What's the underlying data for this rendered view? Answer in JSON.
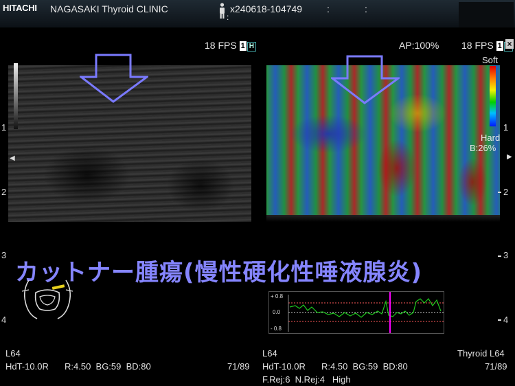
{
  "header": {
    "logo": "HITACHI",
    "clinic": "NAGASAKI Thyroid CLINIC",
    "patient_id": "x240618-104749",
    "sep1": ":",
    "sep2": ":",
    "sep3": ":"
  },
  "left_panel": {
    "fps": "18 FPS",
    "focus_num": "1",
    "focus_mark": "H",
    "depth_marks": [
      "1",
      "2",
      "3",
      "4"
    ],
    "triangle": "◀"
  },
  "right_panel": {
    "ap": "AP:100%",
    "fps": "18 FPS",
    "focus_num": "1",
    "focus_mark": "H",
    "close": "×",
    "scale_soft": "Soft",
    "scale_hard": "Hard",
    "scale_ratio": "B:26%",
    "scale_num": "1",
    "depth_marks": [
      "2",
      "3",
      "4"
    ],
    "triangle": "▶"
  },
  "title_text": "カットナー腫瘍(慢性硬化性唾液腺炎)",
  "strain_graph": {
    "ticks": [
      "+ 0.8",
      "0.0",
      "- 0.8"
    ]
  },
  "footer": {
    "left": {
      "probe": "L64",
      "mode": "HdT-10.0R",
      "params": "R:4.50  BG:59  BD:80",
      "frame": "71/89"
    },
    "right": {
      "probe": "L64",
      "preset": "Thyroid L64",
      "mode": "HdT-10.0R",
      "params": "R:4.50  BG:59  BD:80",
      "frame": "71/89",
      "rej": "F.Rej:6  N.Rej:4   High"
    }
  },
  "colors": {
    "title": "#8585ff",
    "arrow": "#7a7aff",
    "strain_line": "#1ec81e",
    "strain_ref": "#ff5a5a",
    "strain_cursor": "#ff00ff"
  }
}
